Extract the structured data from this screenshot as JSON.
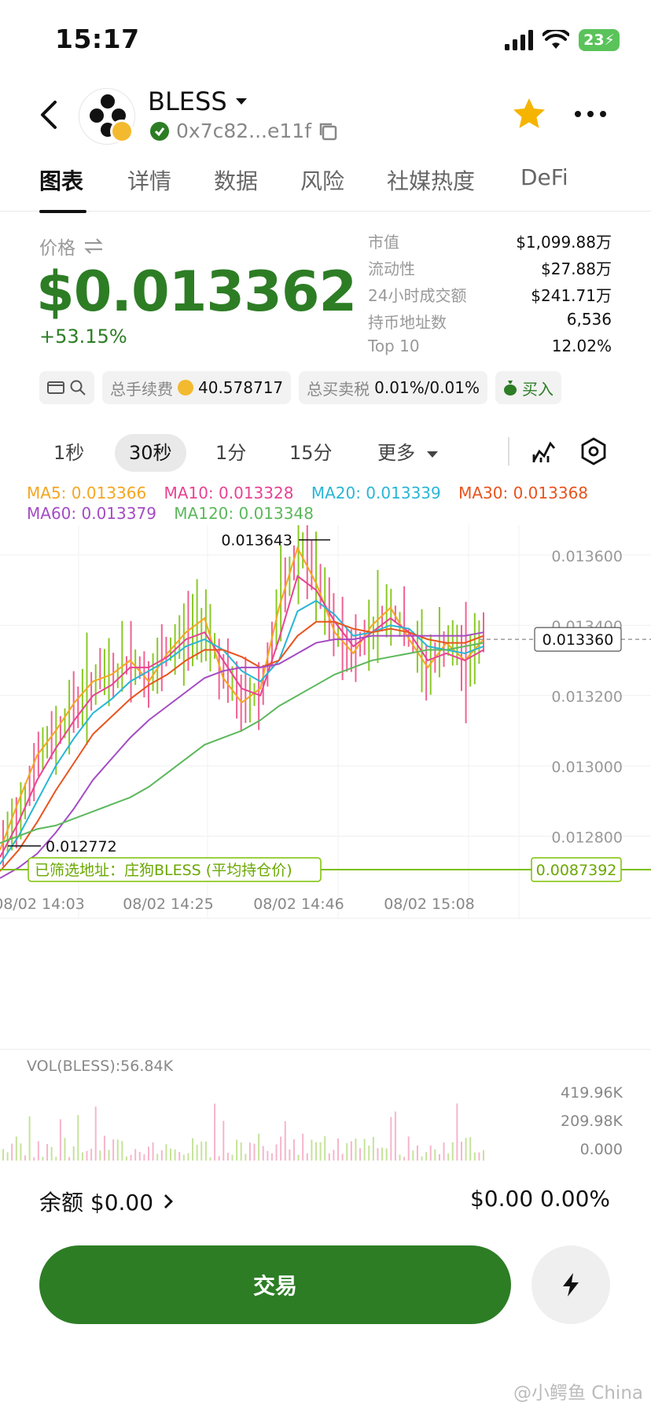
{
  "status_bar": {
    "time": "15:17",
    "battery": "23"
  },
  "header": {
    "token_name": "BLESS",
    "token_address": "0x7c82...e11f"
  },
  "tabs": [
    {
      "label": "图表",
      "active": true
    },
    {
      "label": "详情",
      "active": false
    },
    {
      "label": "数据",
      "active": false
    },
    {
      "label": "风险",
      "active": false
    },
    {
      "label": "社媒热度",
      "active": false
    },
    {
      "label": "DeFi",
      "active": false
    }
  ],
  "price": {
    "label": "价格",
    "value": "$0.013362",
    "change": "+53.15%"
  },
  "stats": [
    {
      "key": "市值",
      "value": "$1,099.88万"
    },
    {
      "key": "流动性",
      "value": "$27.88万"
    },
    {
      "key": "24小时成交额",
      "value": "$241.71万"
    },
    {
      "key": "持币地址数",
      "value": "6,536"
    },
    {
      "key": "Top 10",
      "value": "12.02%"
    }
  ],
  "chips": {
    "fee_label": "总手续费",
    "fee_value": "40.578717",
    "tax_label": "总买卖税",
    "tax_value": "0.01%/0.01%",
    "buy_label": "买入"
  },
  "timeframes": [
    {
      "label": "1秒",
      "active": false
    },
    {
      "label": "30秒",
      "active": true
    },
    {
      "label": "1分",
      "active": false
    },
    {
      "label": "15分",
      "active": false
    },
    {
      "label": "更多",
      "active": false
    }
  ],
  "ma_legend": [
    {
      "text": "MA5: 0.013366",
      "color": "#f5a623"
    },
    {
      "text": "MA10: 0.013328",
      "color": "#e84393"
    },
    {
      "text": "MA20: 0.013339",
      "color": "#29b6d6"
    },
    {
      "text": "MA30: 0.013368",
      "color": "#e8541e"
    },
    {
      "text": "MA60: 0.013379",
      "color": "#a44cc4"
    },
    {
      "text": "MA120: 0.013348",
      "color": "#5cb85c"
    }
  ],
  "chart_data": {
    "type": "line",
    "y_ticks": [
      "0.013600",
      "0.013400",
      "0.013200",
      "0.013000",
      "0.012800"
    ],
    "ylim": [
      0.0127,
      0.01364
    ],
    "x_ticks": [
      "08/02 14:03",
      "08/02 14:25",
      "08/02 14:46",
      "08/02 15:08"
    ],
    "current_price": "0.013360",
    "high_label": "0.013643",
    "low_label": "0.012772",
    "avg_line_value": "0.0087392",
    "avg_line_label": "已筛选地址：庄狗BLESS (平均持仓价)",
    "series": [
      {
        "name": "MA5",
        "color": "#f5a623",
        "values": [
          0.01276,
          0.0129,
          0.01303,
          0.0131,
          0.01318,
          0.01324,
          0.01326,
          0.0133,
          0.01324,
          0.01332,
          0.01338,
          0.01342,
          0.01325,
          0.01318,
          0.01322,
          0.01345,
          0.01362,
          0.01352,
          0.01338,
          0.01332,
          0.0134,
          0.01345,
          0.01336,
          0.01328,
          0.01335,
          0.0133,
          0.01336
        ]
      },
      {
        "name": "MA10",
        "color": "#e84393",
        "values": [
          0.01274,
          0.01284,
          0.01296,
          0.01305,
          0.01313,
          0.0132,
          0.01323,
          0.01328,
          0.01328,
          0.01331,
          0.01336,
          0.01338,
          0.0133,
          0.01322,
          0.0132,
          0.01336,
          0.01354,
          0.0135,
          0.01341,
          0.01334,
          0.01338,
          0.01342,
          0.01338,
          0.0133,
          0.01332,
          0.0133,
          0.01333
        ]
      },
      {
        "name": "MA20",
        "color": "#29b6d6",
        "values": [
          0.01272,
          0.0128,
          0.0129,
          0.013,
          0.01308,
          0.01315,
          0.01319,
          0.01324,
          0.01327,
          0.0133,
          0.01334,
          0.01336,
          0.01333,
          0.01327,
          0.01324,
          0.0133,
          0.01344,
          0.01347,
          0.01343,
          0.01337,
          0.01338,
          0.0134,
          0.01339,
          0.01334,
          0.01333,
          0.01332,
          0.01334
        ]
      },
      {
        "name": "MA30",
        "color": "#e8541e",
        "values": [
          0.0127,
          0.01276,
          0.01284,
          0.01293,
          0.01301,
          0.01309,
          0.01314,
          0.01319,
          0.01323,
          0.01326,
          0.0133,
          0.01333,
          0.01333,
          0.01331,
          0.01328,
          0.0133,
          0.01337,
          0.01341,
          0.01341,
          0.01339,
          0.01338,
          0.01339,
          0.01338,
          0.01336,
          0.01335,
          0.01335,
          0.01337
        ]
      },
      {
        "name": "MA60",
        "color": "#a44cc4",
        "values": [
          0.01268,
          0.01271,
          0.01275,
          0.01281,
          0.01288,
          0.01296,
          0.01302,
          0.01308,
          0.01313,
          0.01317,
          0.01321,
          0.01325,
          0.01327,
          0.01328,
          0.01328,
          0.01329,
          0.01332,
          0.01335,
          0.01336,
          0.01336,
          0.01337,
          0.01337,
          0.01337,
          0.01337,
          0.01337,
          0.01337,
          0.01338
        ]
      },
      {
        "name": "MA120",
        "color": "#5cb85c",
        "values": [
          0.01278,
          0.0128,
          0.01282,
          0.01283,
          0.01285,
          0.01287,
          0.01289,
          0.01291,
          0.01294,
          0.01298,
          0.01302,
          0.01306,
          0.01308,
          0.0131,
          0.01313,
          0.01317,
          0.0132,
          0.01323,
          0.01326,
          0.01328,
          0.0133,
          0.01331,
          0.01332,
          0.01333,
          0.01333,
          0.01334,
          0.01335
        ]
      }
    ]
  },
  "volume": {
    "label": "VOL(BLESS):56.84K",
    "y_ticks": [
      "419.96K",
      "209.98K",
      "0.000"
    ]
  },
  "bottom": {
    "balance": "余额 $0.00",
    "pnl": "$0.00 0.00%",
    "trade_label": "交易"
  },
  "watermark": "@小鳄鱼 China"
}
